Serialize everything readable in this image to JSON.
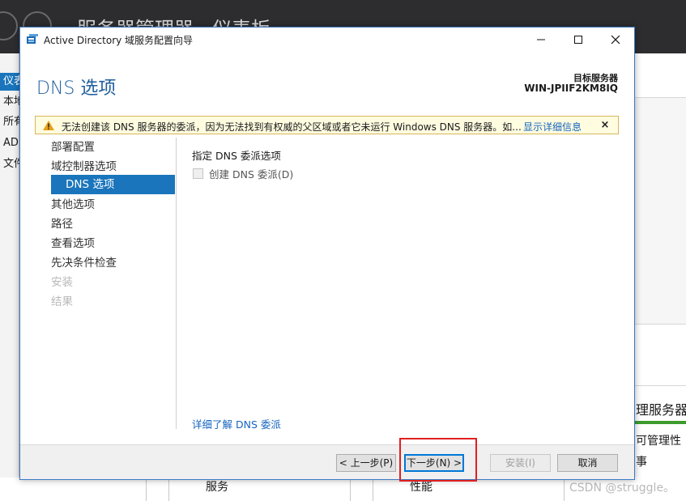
{
  "background_window": {
    "title": "服务器管理器 · 仪表板",
    "sidebar_items": [
      "仪表",
      "本地",
      "所有",
      "AD",
      "文件"
    ],
    "right_panel": {
      "heading": "理服务器",
      "subtext": "可管理性",
      "short": "事"
    },
    "bottom_labels": [
      "服务",
      "性能",
      "服务"
    ]
  },
  "dialog": {
    "title": "Active Directory 域服务配置向导",
    "page_heading": "DNS 选项",
    "target_label": "目标服务器",
    "target_name": "WIN-JPIIF2KM8IQ",
    "warning": {
      "text": "无法创建该 DNS 服务器的委派，因为无法找到有权威的父区域或者它未运行 Windows DNS 服务器。如...",
      "link": "显示详细信息",
      "close": "×"
    },
    "nav_items": [
      {
        "label": "部署配置",
        "state": "normal"
      },
      {
        "label": "域控制器选项",
        "state": "normal"
      },
      {
        "label": "DNS 选项",
        "state": "selected"
      },
      {
        "label": "其他选项",
        "state": "normal"
      },
      {
        "label": "路径",
        "state": "normal"
      },
      {
        "label": "查看选项",
        "state": "normal"
      },
      {
        "label": "先决条件检查",
        "state": "normal"
      },
      {
        "label": "安装",
        "state": "disabled"
      },
      {
        "label": "结果",
        "state": "disabled"
      }
    ],
    "section_title": "指定 DNS 委派选项",
    "checkbox_label": "创建 DNS 委派(D)",
    "checkbox_checked": false,
    "more_link": "详细了解 DNS 委派",
    "buttons": {
      "prev": "< 上一步(P)",
      "next": "下一步(N) >",
      "install": "安装(I)",
      "cancel": "取消"
    }
  },
  "watermark": "CSDN @struggle。",
  "colors": {
    "accent": "#1a75bc",
    "heading": "#1f5e9e",
    "link": "#1565c0",
    "warning_bg": "#fffce0",
    "highlight": "#e02020"
  }
}
